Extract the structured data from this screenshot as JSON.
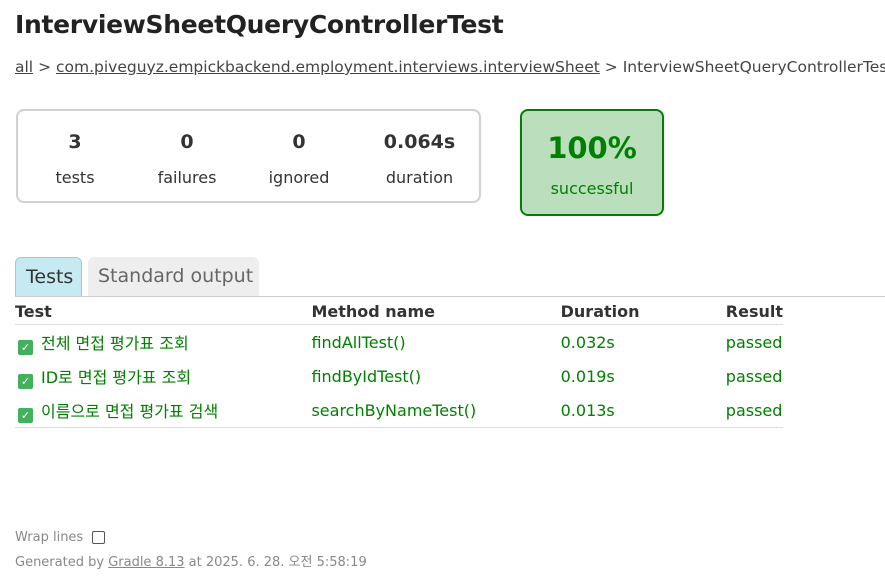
{
  "title": "InterviewSheetQueryControllerTest",
  "breadcrumb": {
    "root": "all",
    "separator": ">",
    "package": "com.piveguyz.empickbackend.employment.interviews.interviewSheet",
    "current": "InterviewSheetQueryControllerTest"
  },
  "summary": {
    "tests": {
      "value": "3",
      "label": "tests"
    },
    "failures": {
      "value": "0",
      "label": "failures"
    },
    "ignored": {
      "value": "0",
      "label": "ignored"
    },
    "duration": {
      "value": "0.064s",
      "label": "duration"
    }
  },
  "success": {
    "percent": "100%",
    "label": "successful",
    "color": "#008000",
    "background": "#bbdfbd"
  },
  "tabs": [
    {
      "label": "Tests",
      "active": true
    },
    {
      "label": "Standard output",
      "active": false
    }
  ],
  "table": {
    "headers": [
      "Test",
      "Method name",
      "Duration",
      "Result"
    ],
    "rows": [
      {
        "test": "전체 면접 평가표 조회",
        "method": "findAllTest()",
        "duration": "0.032s",
        "result": "passed"
      },
      {
        "test": "ID로 면접 평가표 조회",
        "method": "findByIdTest()",
        "duration": "0.019s",
        "result": "passed"
      },
      {
        "test": "이름으로 면접 평가표 검색",
        "method": "searchByNameTest()",
        "duration": "0.013s",
        "result": "passed"
      }
    ]
  },
  "footer": {
    "wrap_lines": "Wrap lines",
    "wrap_checked": false,
    "generated_prefix": "Generated by",
    "generator": "Gradle 8.13",
    "generated_suffix": "at 2025. 6. 28. 오전 5:58:19"
  }
}
